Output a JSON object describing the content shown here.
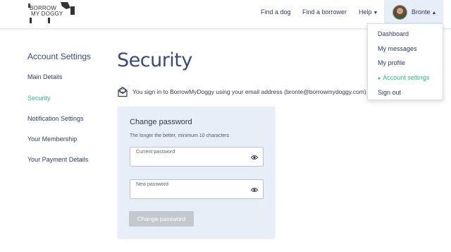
{
  "header": {
    "logo": {
      "line1": "BORROW",
      "line2": "MY DOGGY"
    },
    "nav": {
      "find_dog": "Find a dog",
      "find_borrower": "Find a borrower",
      "help": "Help"
    },
    "user": {
      "name": "Bronte"
    }
  },
  "dropdown": {
    "items": [
      {
        "label": "Dashboard"
      },
      {
        "label": "My messages"
      },
      {
        "label": "My profile"
      },
      {
        "label": "Account settings",
        "active": true
      },
      {
        "label": "Sign out"
      }
    ]
  },
  "sidebar": {
    "title": "Account Settings",
    "items": [
      {
        "label": "Main Details"
      },
      {
        "label": "Security",
        "active": true
      },
      {
        "label": "Notification Settings"
      },
      {
        "label": "Your Membership"
      },
      {
        "label": "Your Payment Details"
      }
    ]
  },
  "main": {
    "title": "Security",
    "info": "You sign in to BorrowMyDoggy using your email address (bronte@borrowmydoggy.com) and",
    "card": {
      "title": "Change password",
      "hint": "The longer the better, minimum 10 characters",
      "current_label": "Current password",
      "new_label": "New password",
      "button": "Change password"
    }
  },
  "colors": {
    "accent_green": "#2bbf84",
    "nav_blue": "#2b3b6b",
    "card_bg": "#e7eef8",
    "button_disabled": "#c4c9cf"
  },
  "icons": [
    "dog-logo-icon",
    "chevron-down-icon",
    "chevron-up-icon",
    "paw-icon",
    "envelope-icon",
    "eye-icon"
  ]
}
